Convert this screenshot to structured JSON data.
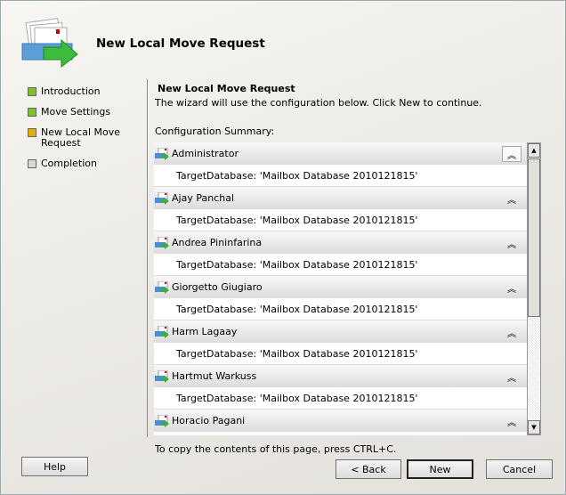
{
  "title": "New Local Move Request",
  "steps": [
    {
      "label": "Introduction",
      "color": "#7ec22a"
    },
    {
      "label": "Move Settings",
      "color": "#7ec22a"
    },
    {
      "label": "New Local Move Request",
      "color": "#e0b000"
    },
    {
      "label": "Completion",
      "color": "#d8d8d8"
    }
  ],
  "panel": {
    "title": "New Local Move Request",
    "description": "The wizard will use the configuration below.  Click New to continue.",
    "summary_label": "Configuration Summary:",
    "items": [
      {
        "name": "Administrator",
        "detail": "TargetDatabase: 'Mailbox Database 2010121815'"
      },
      {
        "name": "Ajay Panchal",
        "detail": "TargetDatabase: 'Mailbox Database 2010121815'"
      },
      {
        "name": "Andrea Pininfarina",
        "detail": "TargetDatabase: 'Mailbox Database 2010121815'"
      },
      {
        "name": "Giorgetto Giugiaro",
        "detail": "TargetDatabase: 'Mailbox Database 2010121815'"
      },
      {
        "name": "Harm Lagaay",
        "detail": "TargetDatabase: 'Mailbox Database 2010121815'"
      },
      {
        "name": "Hartmut Warkuss",
        "detail": "TargetDatabase: 'Mailbox Database 2010121815'"
      },
      {
        "name": "Horacio Pagani",
        "detail": ""
      }
    ],
    "copy_hint": "To copy the contents of this page, press CTRL+C."
  },
  "buttons": {
    "help": "Help",
    "back": "< Back",
    "new": "New",
    "cancel": "Cancel"
  }
}
